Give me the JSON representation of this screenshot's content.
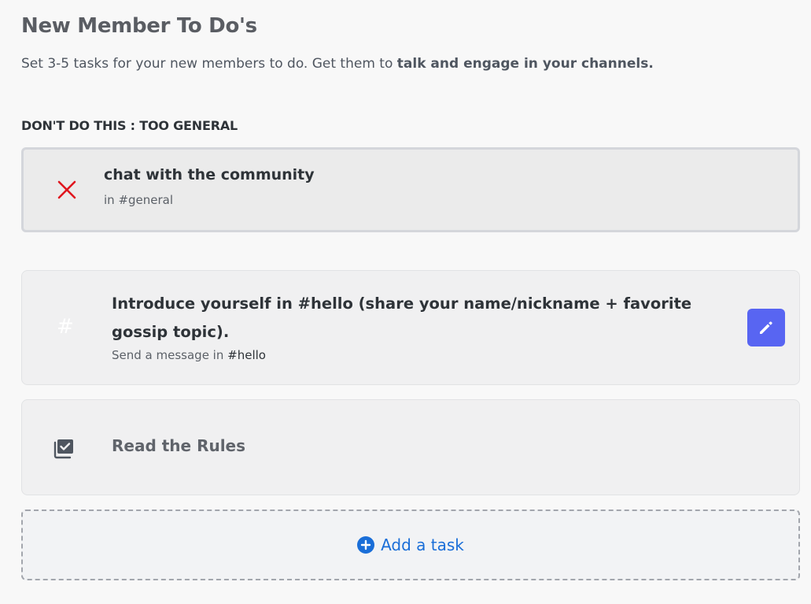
{
  "header": {
    "title": "New Member To Do's",
    "subtitle_prefix": "Set 3-5 tasks for your new members to do. Get them to ",
    "subtitle_bold": "talk and engage in your channels."
  },
  "bad_example": {
    "label": "DON'T DO THIS : TOO GENERAL",
    "title": "chat with the community",
    "subtitle": "in #general",
    "icon": "x-icon",
    "icon_color": "#e0151e"
  },
  "tasks": [
    {
      "icon": "hash-icon",
      "icon_glyph": "#",
      "title": "Introduce yourself in #hello (share your name/nickname + favorite gossip topic).",
      "subtitle_prefix": "Send a message in ",
      "subtitle_channel": "#hello",
      "action": "edit-icon",
      "action_color": "#5865f2"
    },
    {
      "icon": "rules-icon",
      "title": "Read the Rules"
    }
  ],
  "add_task": {
    "label": "Add a task",
    "icon": "plus-circle-icon",
    "color": "#1a6ed8"
  }
}
